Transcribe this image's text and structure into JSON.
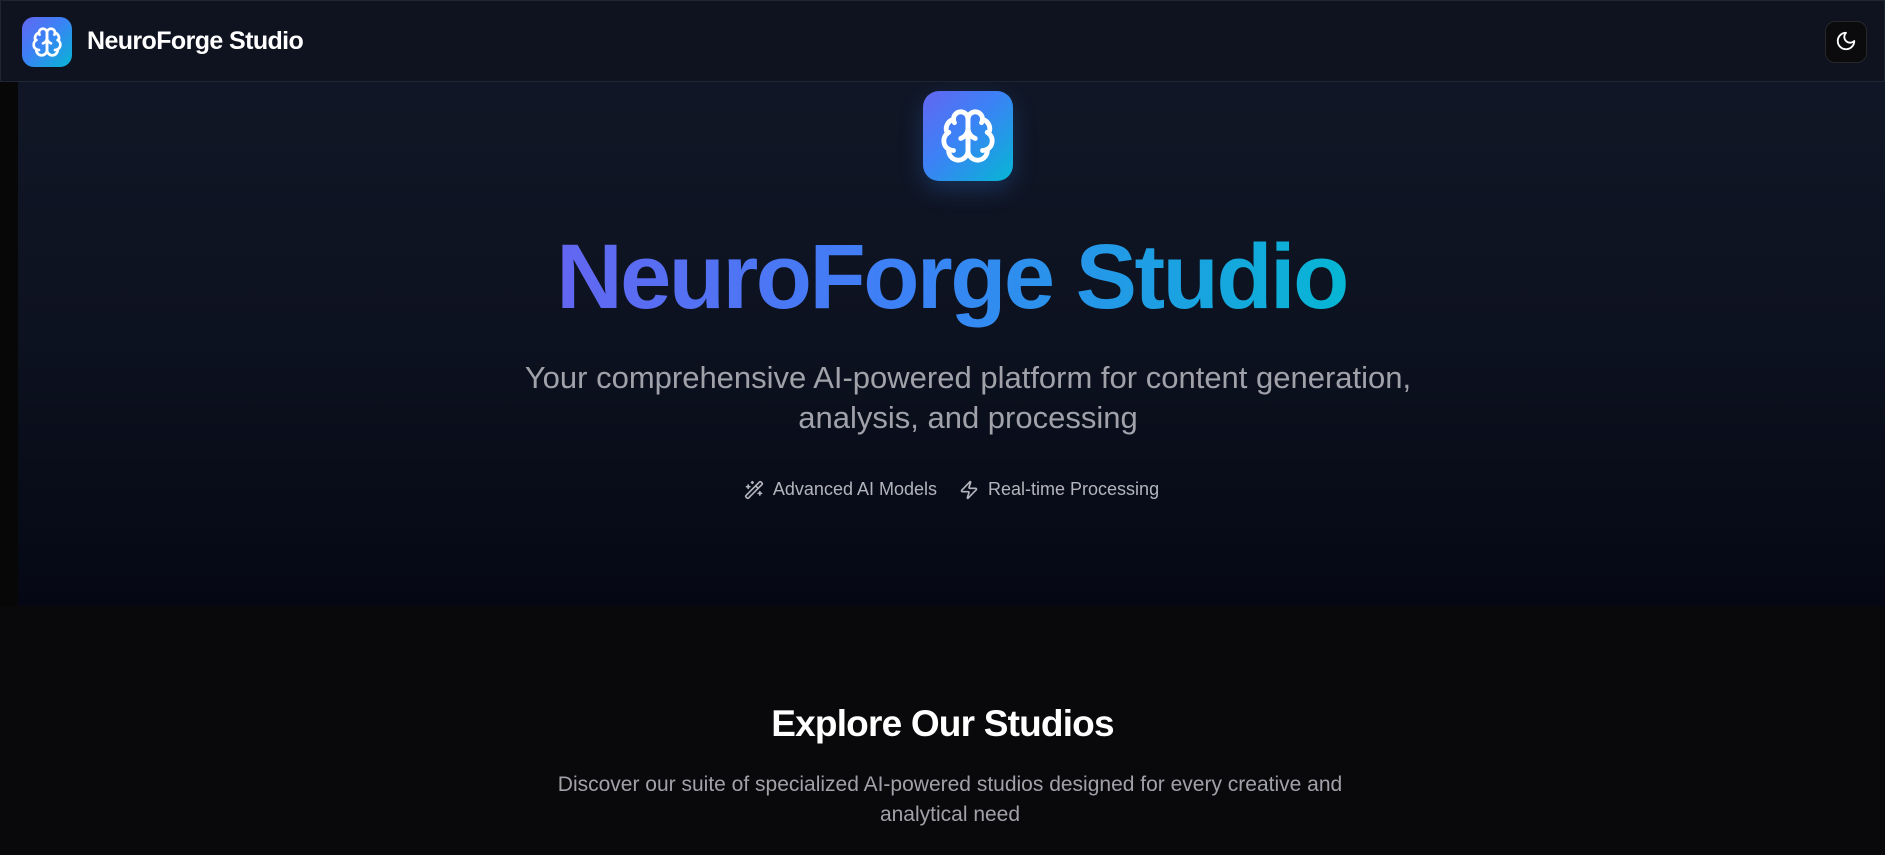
{
  "header": {
    "app_name": "NeuroForge Studio",
    "logo_icon": "brain-icon",
    "theme_toggle_icon": "moon-icon"
  },
  "hero": {
    "title": "NeuroForge Studio",
    "subtitle": "Your comprehensive AI-powered platform for content generation, analysis, and processing",
    "features": [
      {
        "icon": "sparkles-icon",
        "label": "Advanced AI Models"
      },
      {
        "icon": "zap-icon",
        "label": "Real-time Processing"
      }
    ]
  },
  "studios": {
    "title": "Explore Our Studios",
    "description": "Discover our suite of specialized AI-powered studios designed for every creative and analytical need"
  },
  "colors": {
    "gradient_start": "#6366f1",
    "gradient_mid": "#3b82f6",
    "gradient_end": "#06b6d4",
    "background": "#09090b",
    "muted_text": "#a1a1aa"
  }
}
